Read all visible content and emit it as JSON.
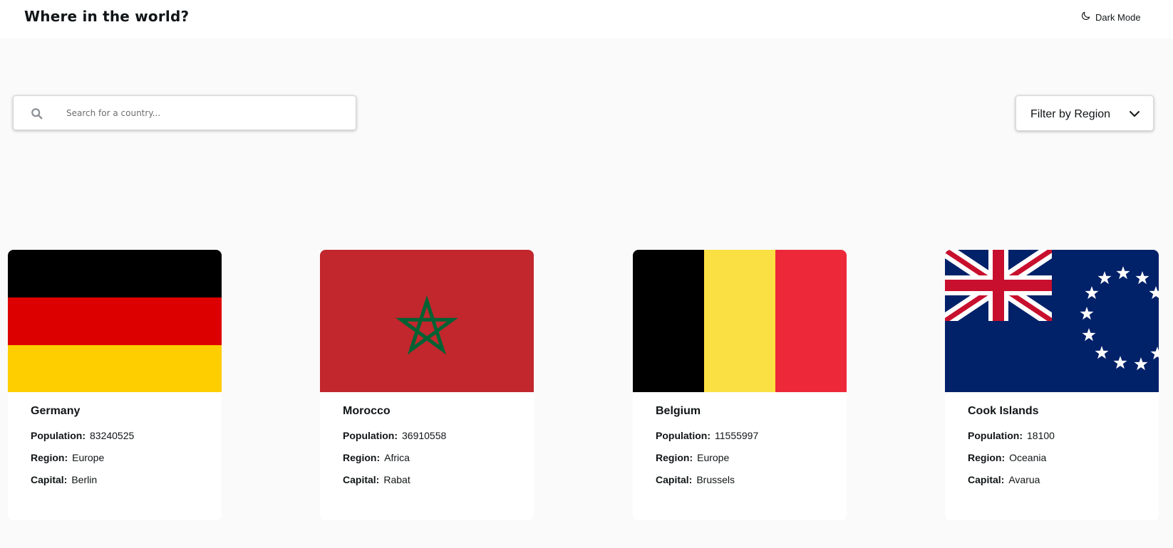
{
  "header": {
    "title": "Where in the world?",
    "dark_mode_label": "Dark Mode",
    "dark_mode_icon": "moon-icon"
  },
  "search": {
    "icon": "search-icon",
    "placeholder": "Search for a country...",
    "value": ""
  },
  "filter": {
    "label": "Filter by Region",
    "icon": "chevron-down-icon"
  },
  "labels": {
    "population": "Population:",
    "region": "Region:",
    "capital": "Capital:"
  },
  "countries": [
    {
      "name": "Germany",
      "population": "83240525",
      "region": "Europe",
      "capital": "Berlin",
      "flag": "germany-flag"
    },
    {
      "name": "Morocco",
      "population": "36910558",
      "region": "Africa",
      "capital": "Rabat",
      "flag": "morocco-flag"
    },
    {
      "name": "Belgium",
      "population": "11555997",
      "region": "Europe",
      "capital": "Brussels",
      "flag": "belgium-flag"
    },
    {
      "name": "Cook Islands",
      "population": "18100",
      "region": "Oceania",
      "capital": "Avarua",
      "flag": "cook-islands-flag"
    }
  ]
}
